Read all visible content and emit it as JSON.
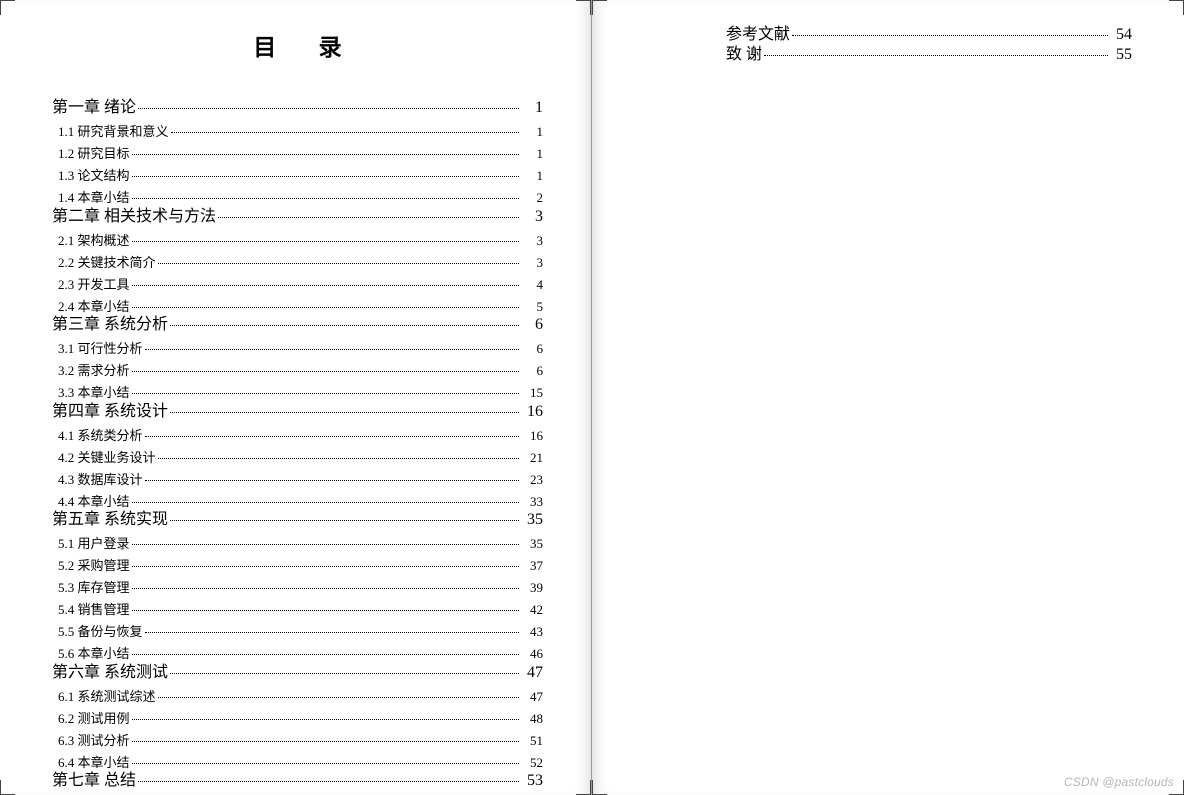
{
  "title": "目 录",
  "left_entries": [
    {
      "level": 1,
      "label": "第一章  绪论",
      "page": "1"
    },
    {
      "level": 2,
      "label": "1.1  研究背景和意义",
      "page": "1"
    },
    {
      "level": 2,
      "label": "1.2  研究目标",
      "page": "1"
    },
    {
      "level": 2,
      "label": "1.3  论文结构",
      "page": "1"
    },
    {
      "level": 2,
      "label": "1.4  本章小结",
      "page": "2"
    },
    {
      "level": 1,
      "label": "第二章  相关技术与方法",
      "page": "3"
    },
    {
      "level": 2,
      "label": "2.1  架构概述",
      "page": "3"
    },
    {
      "level": 2,
      "label": "2.2  关键技术简介",
      "page": "3"
    },
    {
      "level": 2,
      "label": "2.3  开发工具",
      "page": "4"
    },
    {
      "level": 2,
      "label": "2.4  本章小结",
      "page": "5"
    },
    {
      "level": 1,
      "label": "第三章  系统分析",
      "page": "6"
    },
    {
      "level": 2,
      "label": "3.1  可行性分析",
      "page": "6"
    },
    {
      "level": 2,
      "label": "3.2  需求分析",
      "page": "6"
    },
    {
      "level": 2,
      "label": "3.3  本章小结",
      "page": "15"
    },
    {
      "level": 1,
      "label": "第四章  系统设计",
      "page": "16"
    },
    {
      "level": 2,
      "label": "4.1  系统类分析",
      "page": "16"
    },
    {
      "level": 2,
      "label": "4.2  关键业务设计",
      "page": "21"
    },
    {
      "level": 2,
      "label": "4.3  数据库设计",
      "page": "23"
    },
    {
      "level": 2,
      "label": "4.4  本章小结",
      "page": "33"
    },
    {
      "level": 1,
      "label": "第五章  系统实现",
      "page": "35"
    },
    {
      "level": 2,
      "label": "5.1  用户登录",
      "page": "35"
    },
    {
      "level": 2,
      "label": "5.2  采购管理",
      "page": "37"
    },
    {
      "level": 2,
      "label": "5.3  库存管理",
      "page": "39"
    },
    {
      "level": 2,
      "label": "5.4  销售管理",
      "page": "42"
    },
    {
      "level": 2,
      "label": "5.5  备份与恢复",
      "page": "43"
    },
    {
      "level": 2,
      "label": "5.6  本章小结",
      "page": "46"
    },
    {
      "level": 1,
      "label": "第六章  系统测试",
      "page": "47"
    },
    {
      "level": 2,
      "label": "6.1  系统测试综述",
      "page": "47"
    },
    {
      "level": 2,
      "label": "6.2  测试用例",
      "page": "48"
    },
    {
      "level": 2,
      "label": "6.3  测试分析",
      "page": "51"
    },
    {
      "level": 2,
      "label": "6.4  本章小结",
      "page": "52"
    },
    {
      "level": 1,
      "label": "第七章  总结",
      "page": "53"
    }
  ],
  "right_entries": [
    {
      "level": 1,
      "label": "参考文献",
      "page": "54"
    },
    {
      "level": 1,
      "label": "致    谢",
      "page": "55"
    }
  ],
  "watermark": "CSDN @pastclouds"
}
